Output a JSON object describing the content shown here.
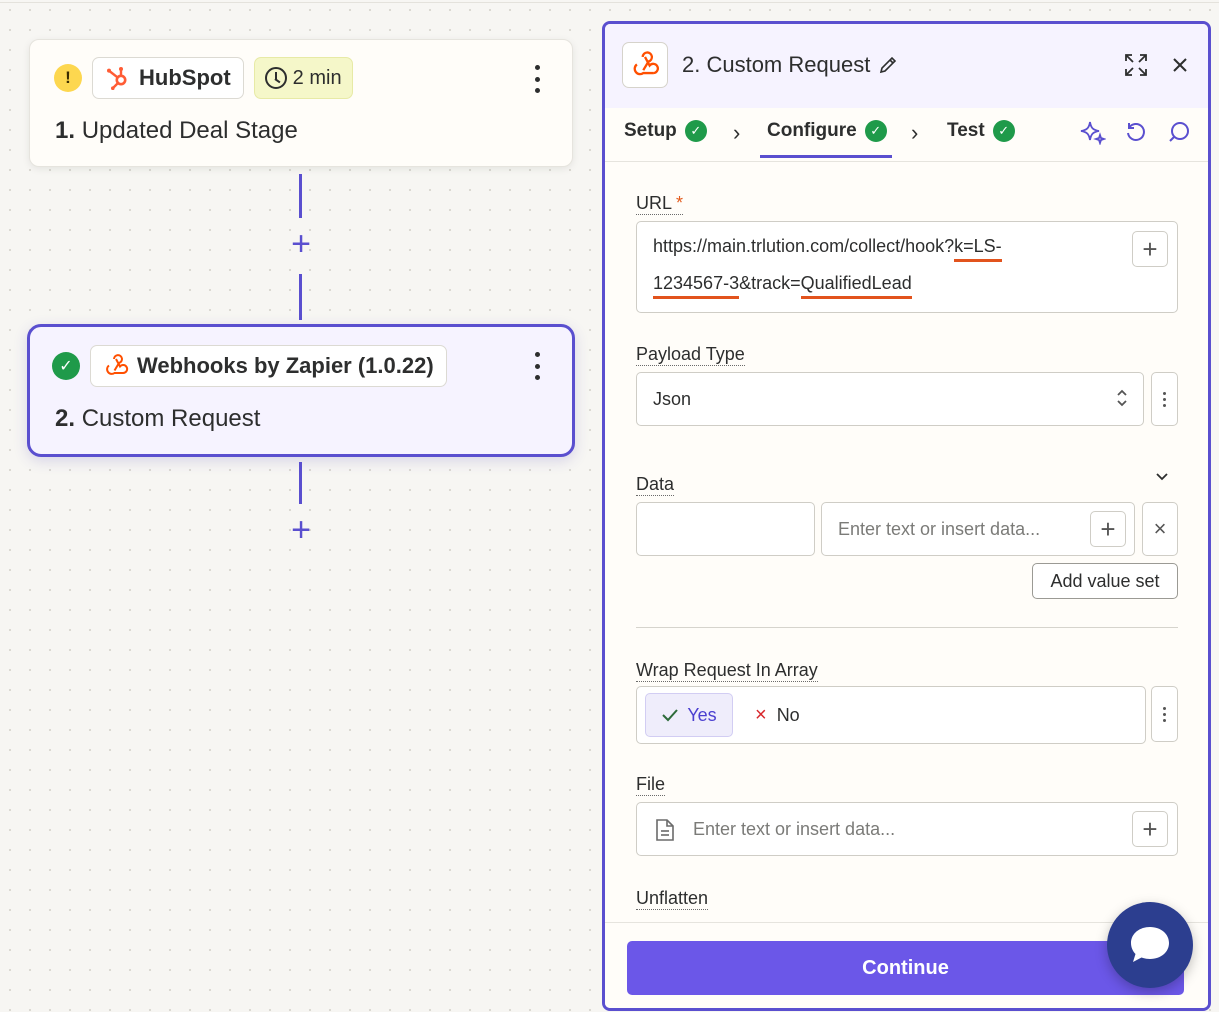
{
  "canvas": {
    "step1": {
      "app_name": "HubSpot",
      "delay": "2 min",
      "number": "1.",
      "title": "Updated Deal Stage"
    },
    "step2": {
      "app_name": "Webhooks by Zapier (1.0.22)",
      "number": "2.",
      "title": "Custom Request"
    },
    "warn_glyph": "!",
    "ok_glyph": "✓",
    "plus_glyph": "+"
  },
  "panel": {
    "title": "2. Custom Request",
    "tabs": [
      {
        "label": "Setup"
      },
      {
        "label": "Configure"
      },
      {
        "label": "Test"
      }
    ],
    "fields": {
      "url": {
        "label": "URL",
        "required_mark": "*",
        "line1_prefix": "https://main.trlution.com/collect/hook?",
        "line1_underlined": "k=LS-",
        "line2_underlined_a": "1234567-3",
        "line2_middle": "&track=",
        "line2_underlined_b": "QualifiedLead"
      },
      "payload_type": {
        "label": "Payload Type",
        "value": "Json"
      },
      "data": {
        "label": "Data",
        "key_value": "",
        "value_placeholder": "Enter text or insert data...",
        "add_button": "Add value set"
      },
      "wrap": {
        "label": "Wrap Request In Array",
        "yes": "Yes",
        "no": "No",
        "selected": "Yes"
      },
      "file": {
        "label": "File",
        "placeholder": "Enter text or insert data..."
      },
      "unflatten": {
        "label": "Unflatten"
      }
    },
    "continue_label": "Continue"
  },
  "colors": {
    "accent": "#5a4fcf",
    "button": "#6b57e8",
    "success": "#1f9a4a",
    "warning": "#fdd74f",
    "url_underline": "#e2531d",
    "zapier_orange": "#ff4f00",
    "chat": "#2c3e8f"
  }
}
